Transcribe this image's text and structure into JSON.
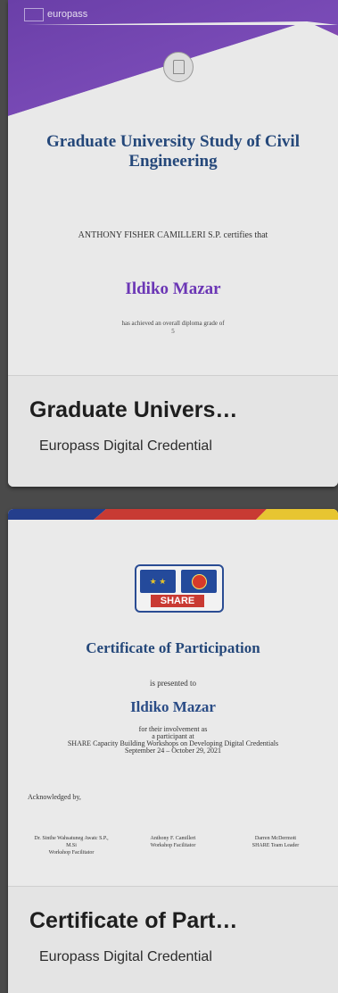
{
  "credentials": [
    {
      "preview": {
        "brand": "europass",
        "title": "Graduate University Study of Civil Engineering",
        "issuer_line": "ANTHONY FISHER CAMILLERI S.P. certifies that",
        "recipient": "Ildiko Mazar",
        "grade_line": "has achieved an overall diploma grade of",
        "grade_value": "5"
      },
      "card_title": "Graduate Univers…",
      "card_subtitle": "Europass Digital Credential"
    },
    {
      "preview": {
        "logo_text": "SHARE",
        "title": "Certificate of Participation",
        "presented_to": "is presented to",
        "recipient": "Ildiko Mazar",
        "body_line1": "for their involvement as",
        "body_line2": "a participant at",
        "body_line3": "SHARE Capacity Building Workshops on Developing Digital Credentials",
        "body_line4": "September 24 – October 29, 2021",
        "acknowledged": "Acknowledged by,",
        "signatories": [
          {
            "name": "Dr. Sinthe Wahsatuneg Awatc S.P., M.Si",
            "role": "Workshop Facilitator"
          },
          {
            "name": "Anthony F. Camilleri",
            "role": "Workshop Facilitator"
          },
          {
            "name": "Darren McDermott",
            "role": "SHARE Team Leader"
          }
        ]
      },
      "card_title": "Certificate of Part…",
      "card_subtitle": "Europass Digital Credential"
    }
  ],
  "colors": {
    "europass_purple": "#6b36b5",
    "certificate_blue": "#25487a",
    "stripe_red": "#c83a33",
    "stripe_yellow": "#e7c531",
    "stripe_navy": "#243e8c"
  }
}
